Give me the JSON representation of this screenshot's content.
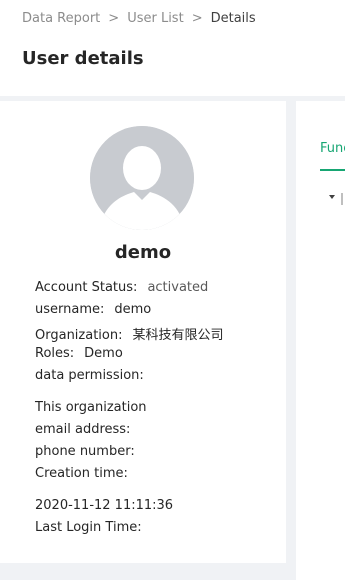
{
  "breadcrumb": {
    "items": [
      "Data Report",
      "User List"
    ],
    "current": "Details"
  },
  "page": {
    "title": "User details"
  },
  "user": {
    "name": "demo",
    "account_status_label": "Account Status:",
    "account_status_value": "activated",
    "username_label": "username:",
    "username_value": "demo",
    "organization_label": "Organization:",
    "organization_value": "某科技有限公司",
    "roles_label": "Roles:",
    "roles_value": "Demo",
    "data_permission_label": "data permission:",
    "data_permission_value": "This organization",
    "email_label": "email address:",
    "phone_label": "phone number:",
    "creation_time_label": "Creation time:",
    "creation_time_value": "2020-11-12 11:11:36",
    "last_login_label": "Last Login Time:"
  },
  "right_panel": {
    "tab_label": "Func"
  },
  "colors": {
    "accent": "#17a673",
    "page_bg": "#f0f2f5",
    "avatar_bg": "#c8cbd0"
  },
  "icons": {
    "avatar": "user-avatar-placeholder-icon",
    "tree": "caret-down-icon"
  }
}
